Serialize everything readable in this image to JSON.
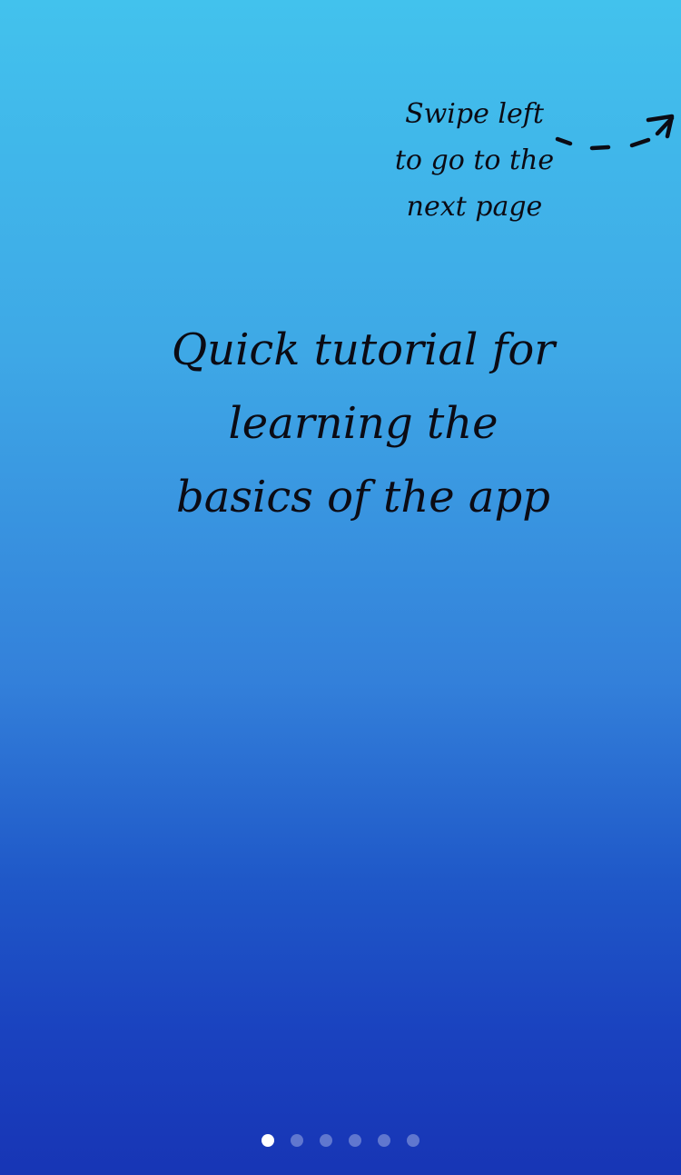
{
  "hint": {
    "lines": [
      "Swipe left",
      "to go to the",
      "next page"
    ]
  },
  "arrow_icon": "dashed-arrow-right-up-icon",
  "title": {
    "lines": [
      "Quick tutorial for",
      "learning the",
      "basics of the app"
    ]
  },
  "pager": {
    "total_pages": 6,
    "current_page": 1
  },
  "colors": {
    "gradient_top": "#42c2ed",
    "gradient_bottom": "#1735b5",
    "text": "#0b0b14",
    "dot_active": "#ffffff",
    "dot_inactive": "#788cd7"
  }
}
